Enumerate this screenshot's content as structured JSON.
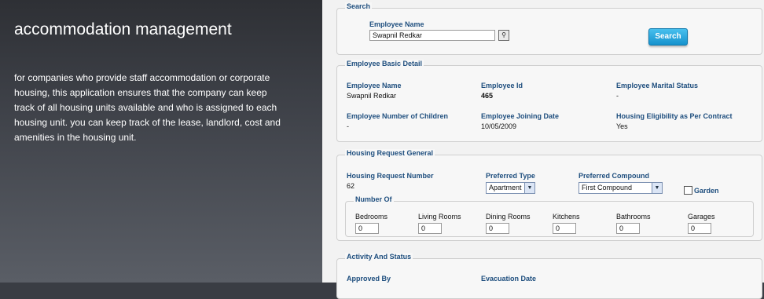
{
  "left": {
    "title": "accommodation management",
    "description": "for companies who provide staff accommodation or corporate housing, this application ensures that the company can keep track of all housing units available and who is assigned to each housing unit.  you can keep track of the lease, landlord, cost and amenities in the housing unit."
  },
  "search": {
    "legend": "Search",
    "employee_name_label": "Employee Name",
    "employee_name_value": "Swapnil Redkar",
    "button_label": "Search"
  },
  "basic": {
    "legend": "Employee Basic Detail",
    "fields": [
      {
        "label": "Employee Name",
        "value": "Swapnil Redkar"
      },
      {
        "label": "Employee Id",
        "value": "465"
      },
      {
        "label": "Employee Marital Status",
        "value": "-"
      },
      {
        "label": "Employee Number of Children",
        "value": "-"
      },
      {
        "label": "Employee Joining Date",
        "value": "10/05/2009"
      },
      {
        "label": "Housing Eligibility as Per Contract",
        "value": "Yes"
      }
    ]
  },
  "housing": {
    "legend": "Housing Request General",
    "request_number_label": "Housing Request Number",
    "request_number_value": "62",
    "preferred_type_label": "Preferred Type",
    "preferred_type_value": "Apartment",
    "preferred_compound_label": "Preferred Compound",
    "preferred_compound_value": "First Compound",
    "garden_label": "Garden",
    "number_of": {
      "legend": "Number Of",
      "items": [
        {
          "label": "Bedrooms",
          "value": "0"
        },
        {
          "label": "Living Rooms",
          "value": "0"
        },
        {
          "label": "Dining Rooms",
          "value": "0"
        },
        {
          "label": "Kitchens",
          "value": "0"
        },
        {
          "label": "Bathrooms",
          "value": "0"
        },
        {
          "label": "Garages",
          "value": "0"
        }
      ]
    }
  },
  "activity": {
    "legend": "Activity And Status",
    "approved_by_label": "Approved By",
    "evacuation_date_label": "Evacuation Date"
  }
}
